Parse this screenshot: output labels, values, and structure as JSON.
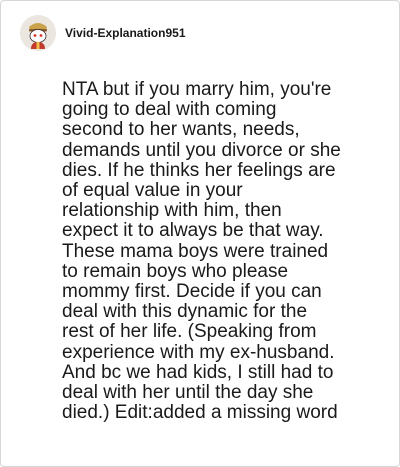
{
  "comment": {
    "username": "Vivid-Explanation951",
    "avatar": "snoo-avatar-icon",
    "lines": [
      "NTA but if you marry him, you're",
      "going to deal with coming",
      "second to her wants, needs,",
      "demands until you divorce or she",
      "dies. If he thinks her feelings are",
      "of equal value in your",
      "relationship with him, then",
      "expect it to always be that way.",
      "These mama boys were trained",
      "to remain boys who please",
      "mommy first. Decide if you can",
      "deal with this dynamic for the",
      "rest of her life. (Speaking from",
      "experience with my ex-husband.",
      "And bc we had kids, I still had to",
      "deal with her until the day she",
      "died.) Edit:added a missing word"
    ]
  }
}
